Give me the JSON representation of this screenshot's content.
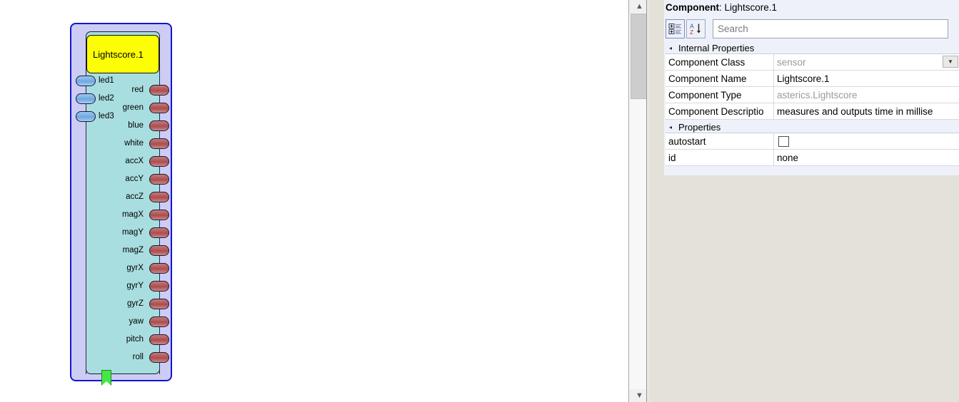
{
  "canvas": {
    "component": {
      "title": "Lightscore.1",
      "colors": {
        "outer_border": "#1414d2",
        "outer_fill": "#ccccf5",
        "body_fill": "#a9dee1",
        "title_fill": "#fdfd05",
        "input_port": "#6fa8e0",
        "output_port": "#ab4d4d",
        "flag": "#44e845"
      },
      "flag_icon": "green-flag-marker",
      "input_ports": [
        {
          "label": "led1"
        },
        {
          "label": "led2"
        },
        {
          "label": "led3"
        }
      ],
      "output_ports": [
        {
          "label": "red"
        },
        {
          "label": "green"
        },
        {
          "label": "blue"
        },
        {
          "label": "white"
        },
        {
          "label": "accX"
        },
        {
          "label": "accY"
        },
        {
          "label": "accZ"
        },
        {
          "label": "magX"
        },
        {
          "label": "magY"
        },
        {
          "label": "magZ"
        },
        {
          "label": "gyrX"
        },
        {
          "label": "gyrY"
        },
        {
          "label": "gyrZ"
        },
        {
          "label": "yaw"
        },
        {
          "label": "pitch"
        },
        {
          "label": "roll"
        }
      ]
    }
  },
  "scrollbar": {
    "up_icon": "chevron-up-icon",
    "down_icon": "chevron-down-icon"
  },
  "panel": {
    "header_prefix": "Component",
    "header_separator": ": ",
    "header_value": "Lightscore.1",
    "toolbar": {
      "categorize_icon": "categorized-view-icon",
      "sort_icon": "alphabetical-sort-icon"
    },
    "search": {
      "placeholder": "Search",
      "value": ""
    },
    "sections": [
      {
        "name": "Internal Properties",
        "expanded_glyph": "◂",
        "rows": [
          {
            "name": "Component Class",
            "value": "sensor",
            "readonly": true,
            "control": "dropdown",
            "dropdown_glyph": "▼"
          },
          {
            "name": "Component Name",
            "value": "Lightscore.1",
            "readonly": false,
            "control": "text"
          },
          {
            "name": "Component Type",
            "value": "asterics.Lightscore",
            "readonly": true,
            "control": "text"
          },
          {
            "name": "Component Descriptio",
            "value": "measures and outputs time in millise",
            "readonly": false,
            "control": "text"
          }
        ]
      },
      {
        "name": "Properties",
        "expanded_glyph": "◂",
        "rows": [
          {
            "name": "autostart",
            "value": "",
            "readonly": false,
            "control": "checkbox",
            "checked": false
          },
          {
            "name": "id",
            "value": "none",
            "readonly": false,
            "control": "text"
          }
        ]
      }
    ]
  }
}
